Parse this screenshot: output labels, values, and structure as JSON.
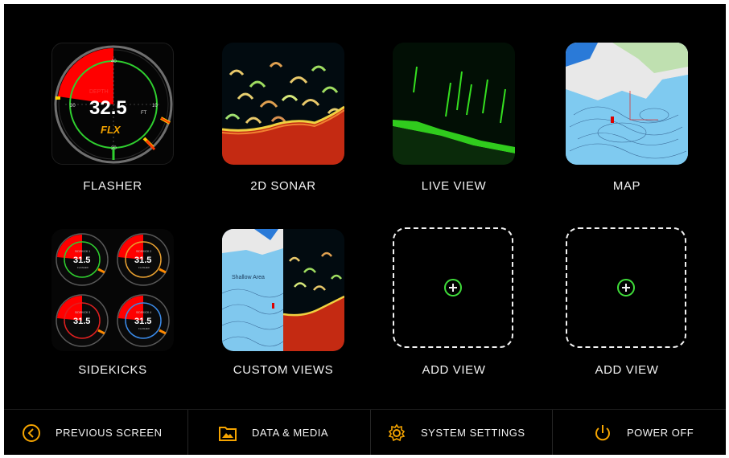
{
  "tiles": [
    {
      "label": "FLASHER",
      "flasher": {
        "depth_label": "DEPTH",
        "depth_value": "32.5",
        "unit": "FT",
        "brand": "FLX",
        "scale": [
          "40",
          "30",
          "10",
          "20"
        ]
      }
    },
    {
      "label": "2D SONAR"
    },
    {
      "label": "LIVE VIEW"
    },
    {
      "label": "MAP"
    },
    {
      "label": "SIDEKICKS",
      "sidekicks": {
        "depth_value": "31.5",
        "labels": [
          "SIDEKICK 1",
          "SIDEKICK 2",
          "SIDEKICK 3",
          "SIDEKICK 4"
        ],
        "sub": "FLASHER"
      }
    },
    {
      "label": "CUSTOM VIEWS",
      "map_text": "Shallow Area"
    },
    {
      "label": "ADD VIEW"
    },
    {
      "label": "ADD VIEW"
    }
  ],
  "bottom_bar": {
    "previous": "PREVIOUS SCREEN",
    "data_media": "DATA & MEDIA",
    "settings": "SYSTEM SETTINGS",
    "power": "POWER OFF"
  },
  "colors": {
    "accent": "#f5a400",
    "add_plus": "#3fdd3a",
    "flasher_red": "#ff0000",
    "map_water": "#78c4ea",
    "sonar_bottom": "#c42a12"
  },
  "icons": [
    "chevron-left-icon",
    "folder-image-icon",
    "gear-icon",
    "power-icon"
  ]
}
